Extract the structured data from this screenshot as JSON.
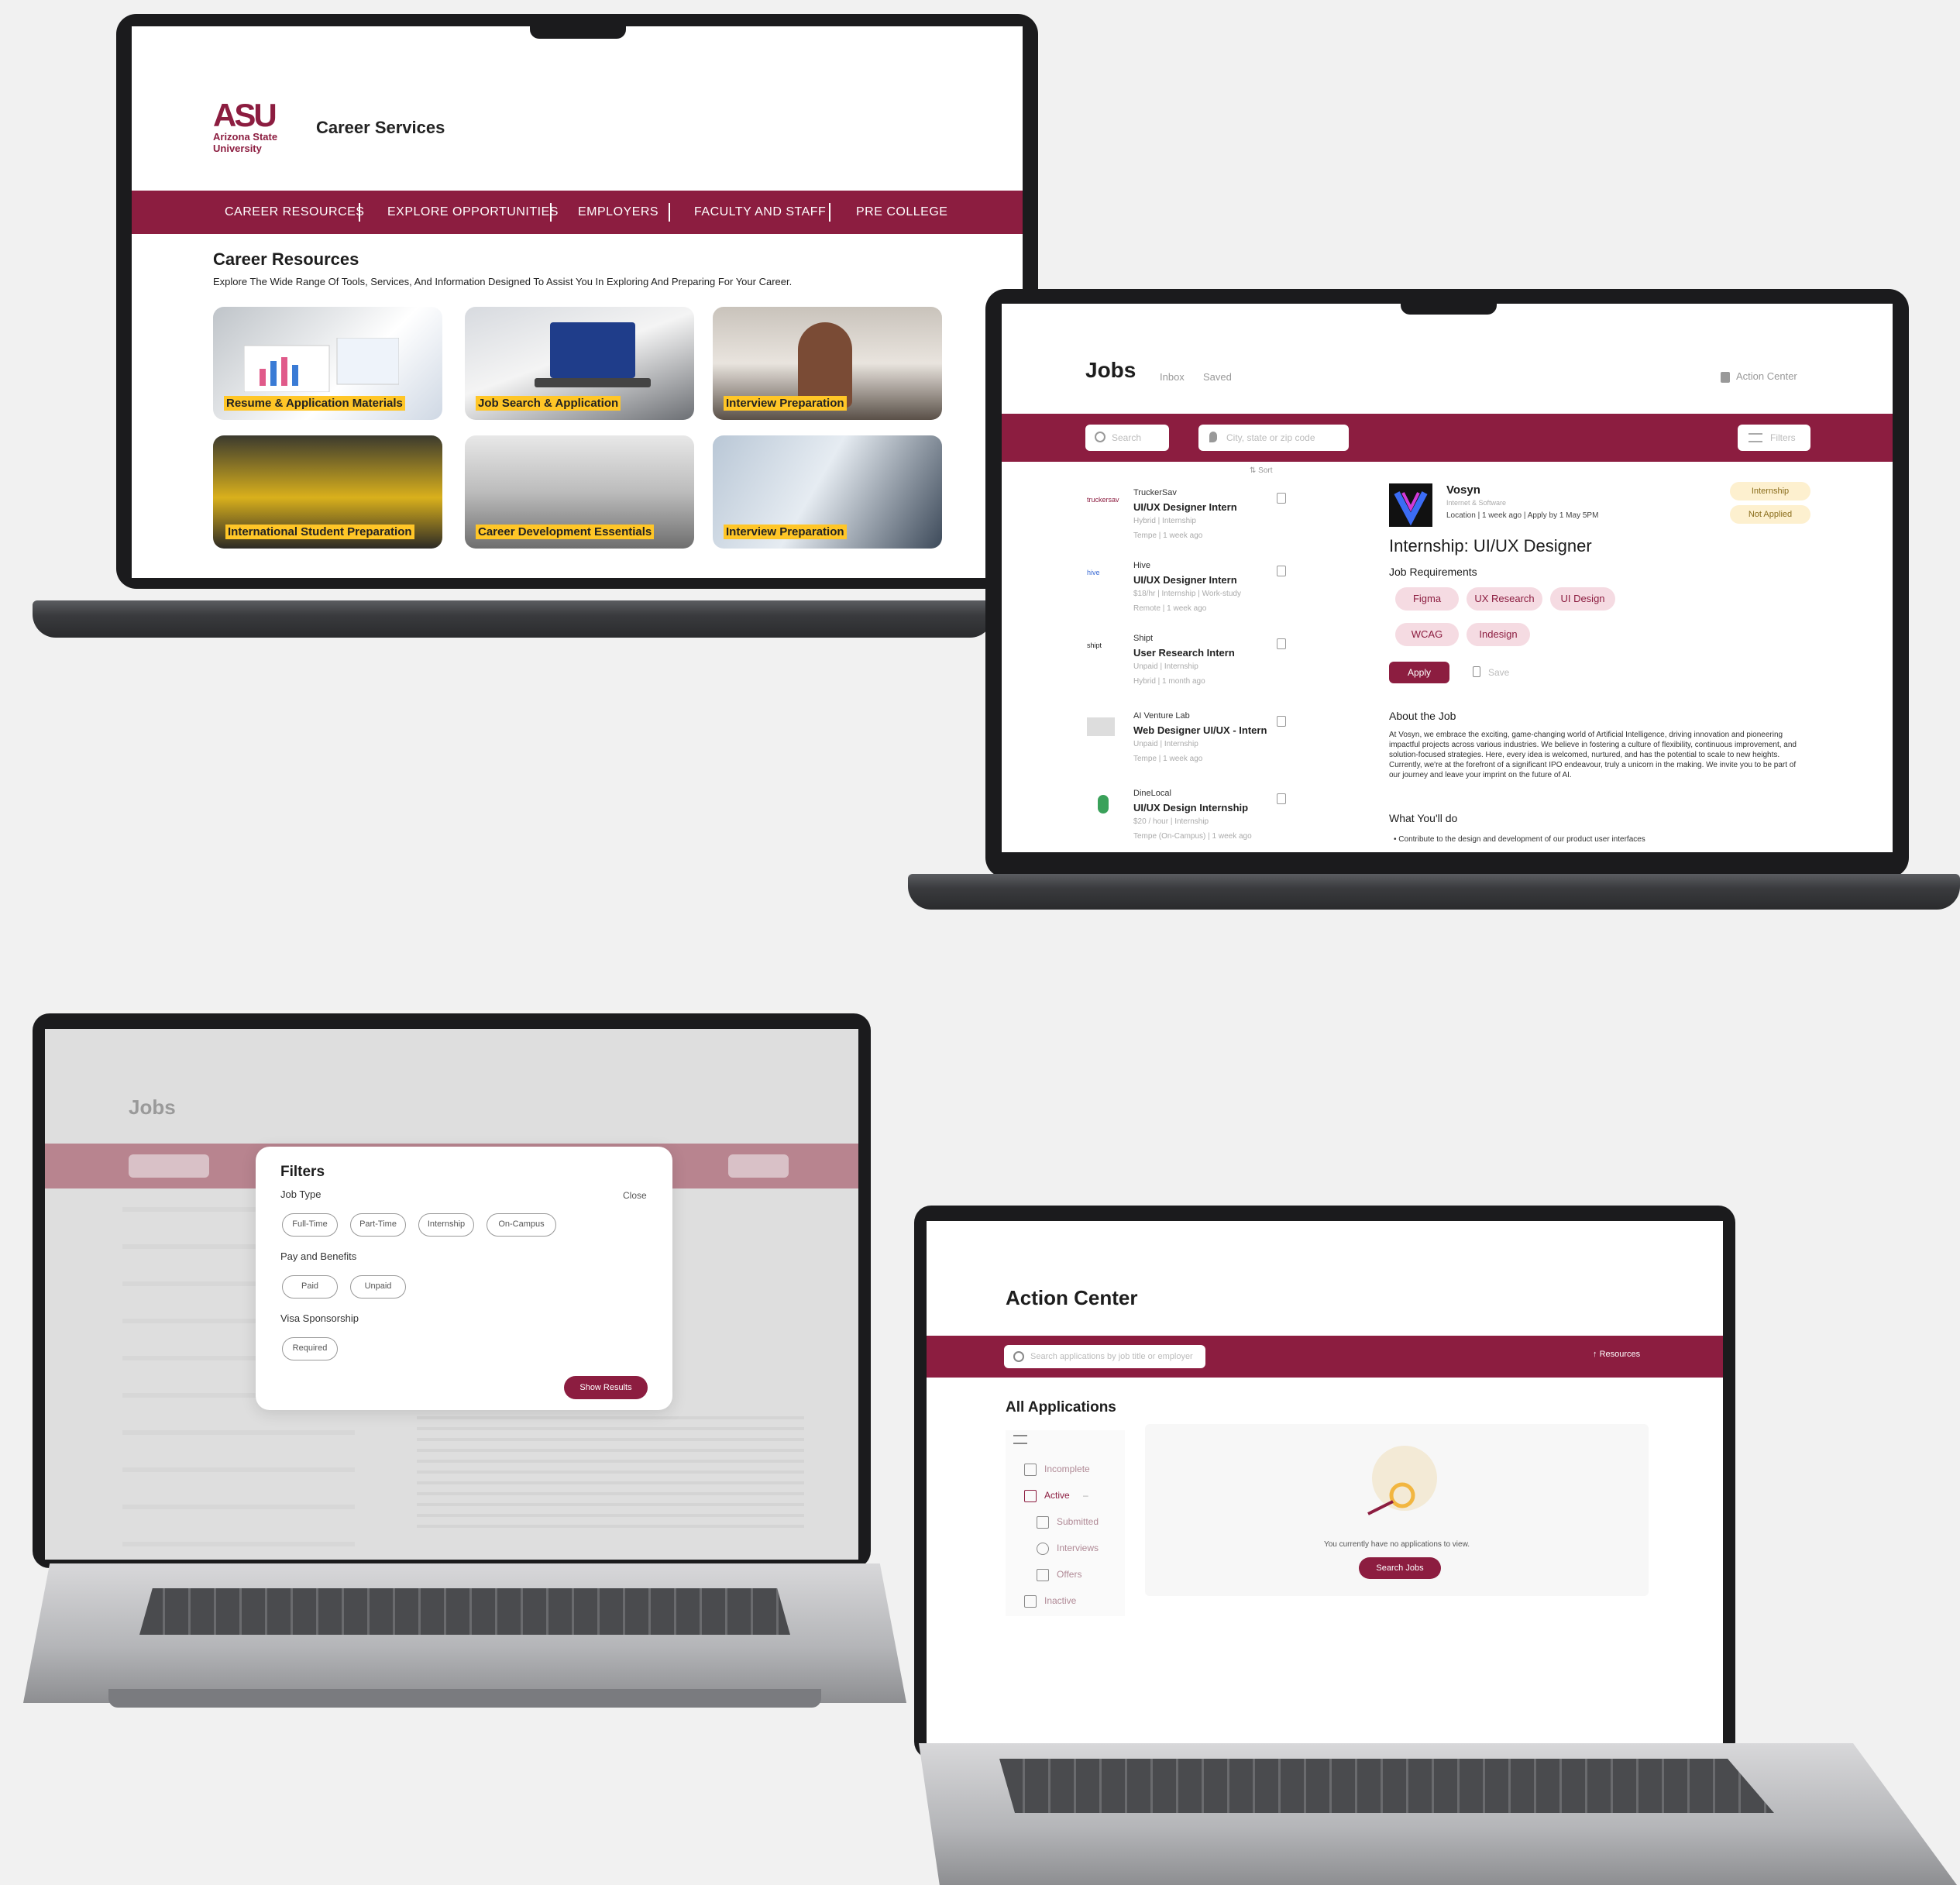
{
  "laptop1": {
    "brand": {
      "logo_text": "ASU",
      "logo_sub1": "Arizona State",
      "logo_sub2": "University",
      "title": "Career Services"
    },
    "nav": [
      "CAREER RESOURCES",
      "EXPLORE OPPORTUNITIES",
      "EMPLOYERS",
      "FACULTY AND STAFF",
      "PRE COLLEGE"
    ],
    "section": {
      "title": "Career Resources",
      "subtitle": "Explore The Wide Range Of Tools, Services, And Information Designed To Assist You In Exploring And Preparing For Your Career."
    },
    "tiles": [
      "Resume & Application Materials",
      "Job Search & Application",
      "Interview Preparation",
      "International Student Preparation",
      "Career Development Essentials",
      "Interview Preparation"
    ]
  },
  "laptop2": {
    "header": {
      "title": "Jobs",
      "tab_inbox": "Inbox",
      "tab_saved": "Saved",
      "action_center": "Action Center"
    },
    "toolbar": {
      "search_placeholder": "Search",
      "location_placeholder": "City, state or zip code",
      "filters_label": "Filters"
    },
    "list_header": {
      "sort": "Sort"
    },
    "jobs": [
      {
        "company": "TruckerSav",
        "title": "UI/UX Designer Intern",
        "meta": "Hybrid  |  Internship",
        "meta2": "Tempe  |  1 week ago"
      },
      {
        "company": "Hive",
        "title": "UI/UX Designer Intern",
        "meta": "$18/hr  |  Internship  |  Work-study",
        "meta2": "Remote  |  1 week ago"
      },
      {
        "company": "Shipt",
        "title": "User Research Intern",
        "meta": "Unpaid  |  Internship",
        "meta2": "Hybrid  |  1 month ago"
      },
      {
        "company": "AI Venture Lab",
        "title": "Web Designer UI/UX - Intern",
        "meta": "Unpaid  |  Internship",
        "meta2": "Tempe  |  1 week ago"
      },
      {
        "company": "DineLocal",
        "title": "UI/UX Design Internship",
        "meta": "$20 / hour  |  Internship",
        "meta2": "Tempe (On-Campus)  |  1 week ago"
      }
    ],
    "detail": {
      "company": "Vosyn",
      "company_sub": "Internet & Software",
      "meta": "Location | 1 week ago | Apply by 1 May 5PM",
      "badge_type": "Internship",
      "badge_status": "Not Applied",
      "title": "Internship: UI/UX Designer",
      "req_label": "Job Requirements",
      "skills": [
        "Figma",
        "UX Research",
        "UI Design",
        "WCAG",
        "Indesign"
      ],
      "apply_label": "Apply",
      "save_label": "Save",
      "about_label": "About the Job",
      "about_text": "At Vosyn, we embrace the exciting, game-changing world of Artificial Intelligence, driving innovation and pioneering impactful projects across various industries. We believe in fostering a culture of flexibility, continuous improvement, and solution-focused strategies. Here, every idea is welcomed, nurtured, and has the potential to scale to new heights. Currently, we're at the forefront of a significant IPO endeavour, truly a unicorn in the making. We invite you to be part of our journey and leave your imprint on the future of AI.",
      "todo_label": "What You'll do",
      "todo_item": "Contribute to the design and development of our product user interfaces"
    }
  },
  "laptop3": {
    "bg_title": "Jobs",
    "modal": {
      "title": "Filters",
      "close_label": "Close",
      "job_type_label": "Job Type",
      "job_types": [
        "Full-Time",
        "Part-Time",
        "Internship",
        "On-Campus"
      ],
      "pay_label": "Pay and Benefits",
      "pay_options": [
        "Paid",
        "Unpaid"
      ],
      "visa_label": "Visa Sponsorship",
      "visa_options": [
        "Required"
      ],
      "show_results_label": "Show Results"
    }
  },
  "laptop4": {
    "title": "Action Center",
    "search_placeholder": "Search applications by job title or employer",
    "resources_label": "Resources",
    "section_title": "All Applications",
    "sidebar": [
      "Incomplete",
      "Active",
      "Submitted",
      "Interviews",
      "Offers",
      "Inactive"
    ],
    "empty_message": "You currently have no applications to view.",
    "search_jobs_label": "Search Jobs"
  },
  "colors": {
    "maroon": "#8c1d40",
    "gold": "#ffc627",
    "bg": "#f1f1f1"
  }
}
